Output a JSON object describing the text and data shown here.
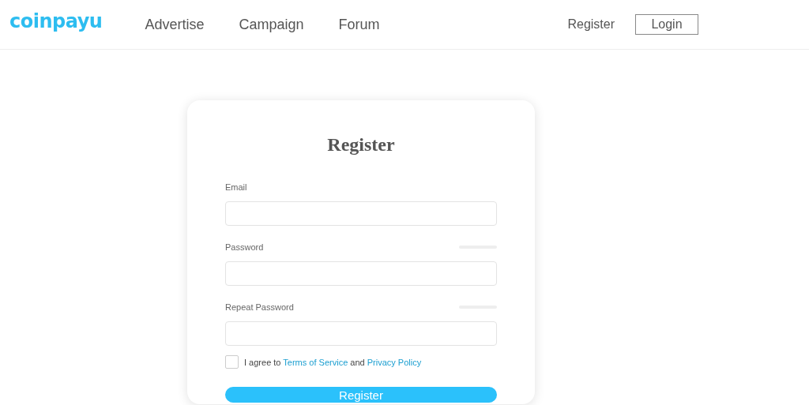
{
  "header": {
    "logo": "coinpayu",
    "nav": [
      "Advertise",
      "Campaign",
      "Forum"
    ],
    "register": "Register",
    "login": "Login"
  },
  "form": {
    "title": "Register",
    "fields": [
      {
        "label": "Email",
        "kind": "plain"
      },
      {
        "label": "Password",
        "kind": "meter"
      },
      {
        "label": "Repeat Password",
        "kind": "meter"
      }
    ],
    "agree": {
      "checked": false,
      "prefix": "I agree to",
      "terms": "Terms of Service",
      "middle": "and",
      "privacy": "Privacy Policy"
    },
    "submit": "Register"
  }
}
